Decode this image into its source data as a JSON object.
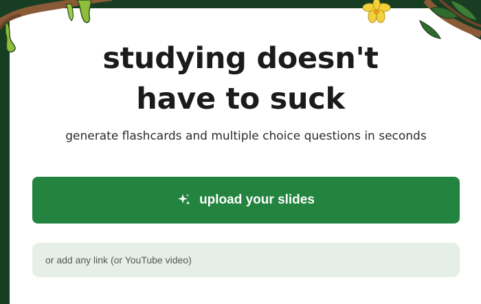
{
  "hero": {
    "title_line1": "studying doesn't",
    "title_line2": "have to suck",
    "subtitle": "generate flashcards and multiple choice questions in seconds"
  },
  "upload": {
    "label": "upload your slides",
    "icon": "sparkles-icon"
  },
  "link_input": {
    "placeholder": "or add any link (or YouTube video)",
    "value": ""
  },
  "colors": {
    "background": "#173d23",
    "card": "#ffffff",
    "primary": "#23843f",
    "input_bg": "#e5efe8",
    "vine": "#8a5a36",
    "moss": "#8fbf3a",
    "flower": "#f2d23a"
  }
}
